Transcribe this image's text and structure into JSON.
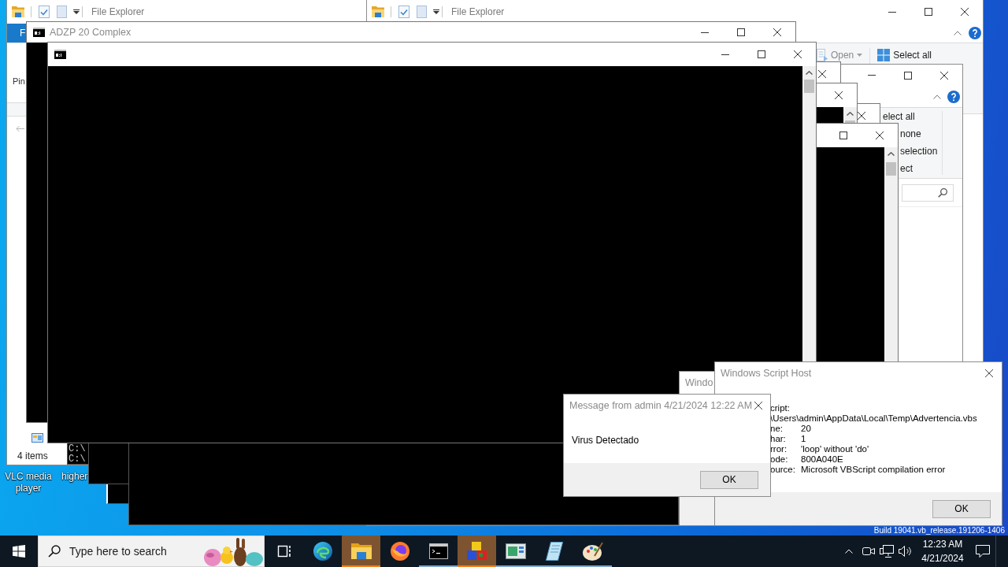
{
  "desktop": {
    "icons": [
      {
        "label": "VLC media player"
      },
      {
        "label": "higher"
      }
    ],
    "build_info": "Build 19041.vb_release.191206-1406"
  },
  "explorer_left": {
    "title": "File Explorer",
    "ribbon_tab": "F",
    "ribbon_label": "Pin",
    "status": "4 items"
  },
  "explorer_right": {
    "title": "File Explorer",
    "ribbon_commands": [
      {
        "label": "Open",
        "dropdown": true,
        "disabled": true
      },
      {
        "label": "Select all",
        "dropdown": false,
        "disabled": false
      }
    ]
  },
  "explorer_small": {
    "ribbon_commands": [
      "elect all",
      "none",
      "selection",
      "ect"
    ]
  },
  "console_window": {
    "title": "ADZP 20 Complex"
  },
  "console_fragment": {
    "lines": [
      "C:\\",
      "C:\\"
    ]
  },
  "partial_window": {
    "title": "Windo"
  },
  "script_error_dialog": {
    "title": "Windows Script Host",
    "script_label": "cript:",
    "script_path": "\\Users\\admin\\AppData\\Local\\Temp\\Advertencia.vbs",
    "fields": [
      {
        "label": "ne:",
        "value": "20"
      },
      {
        "label": "har:",
        "value": "1"
      },
      {
        "label": "rror:",
        "value": "'loop' without 'do'"
      },
      {
        "label": "ode:",
        "value": "800A040E"
      },
      {
        "label": "ource:",
        "value": "Microsoft VBScript compilation error"
      }
    ],
    "button": "OK"
  },
  "message_dialog": {
    "title": "Message from admin 4/21/2024 12:22 AM",
    "message": "Virus Detectado",
    "button": "OK"
  },
  "taskbar": {
    "search": {
      "placeholder": "Type here to search"
    },
    "apps": [
      {
        "running": false,
        "flashing": false
      },
      {
        "running": true,
        "flashing": true
      },
      {
        "running": false,
        "flashing": false
      },
      {
        "running": true,
        "flashing": false
      },
      {
        "running": true,
        "flashing": true
      },
      {
        "running": true,
        "flashing": false
      },
      {
        "running": true,
        "flashing": false
      },
      {
        "running": true,
        "flashing": false
      }
    ],
    "clock": {
      "time": "12:23 AM",
      "date": "4/21/2024"
    }
  }
}
